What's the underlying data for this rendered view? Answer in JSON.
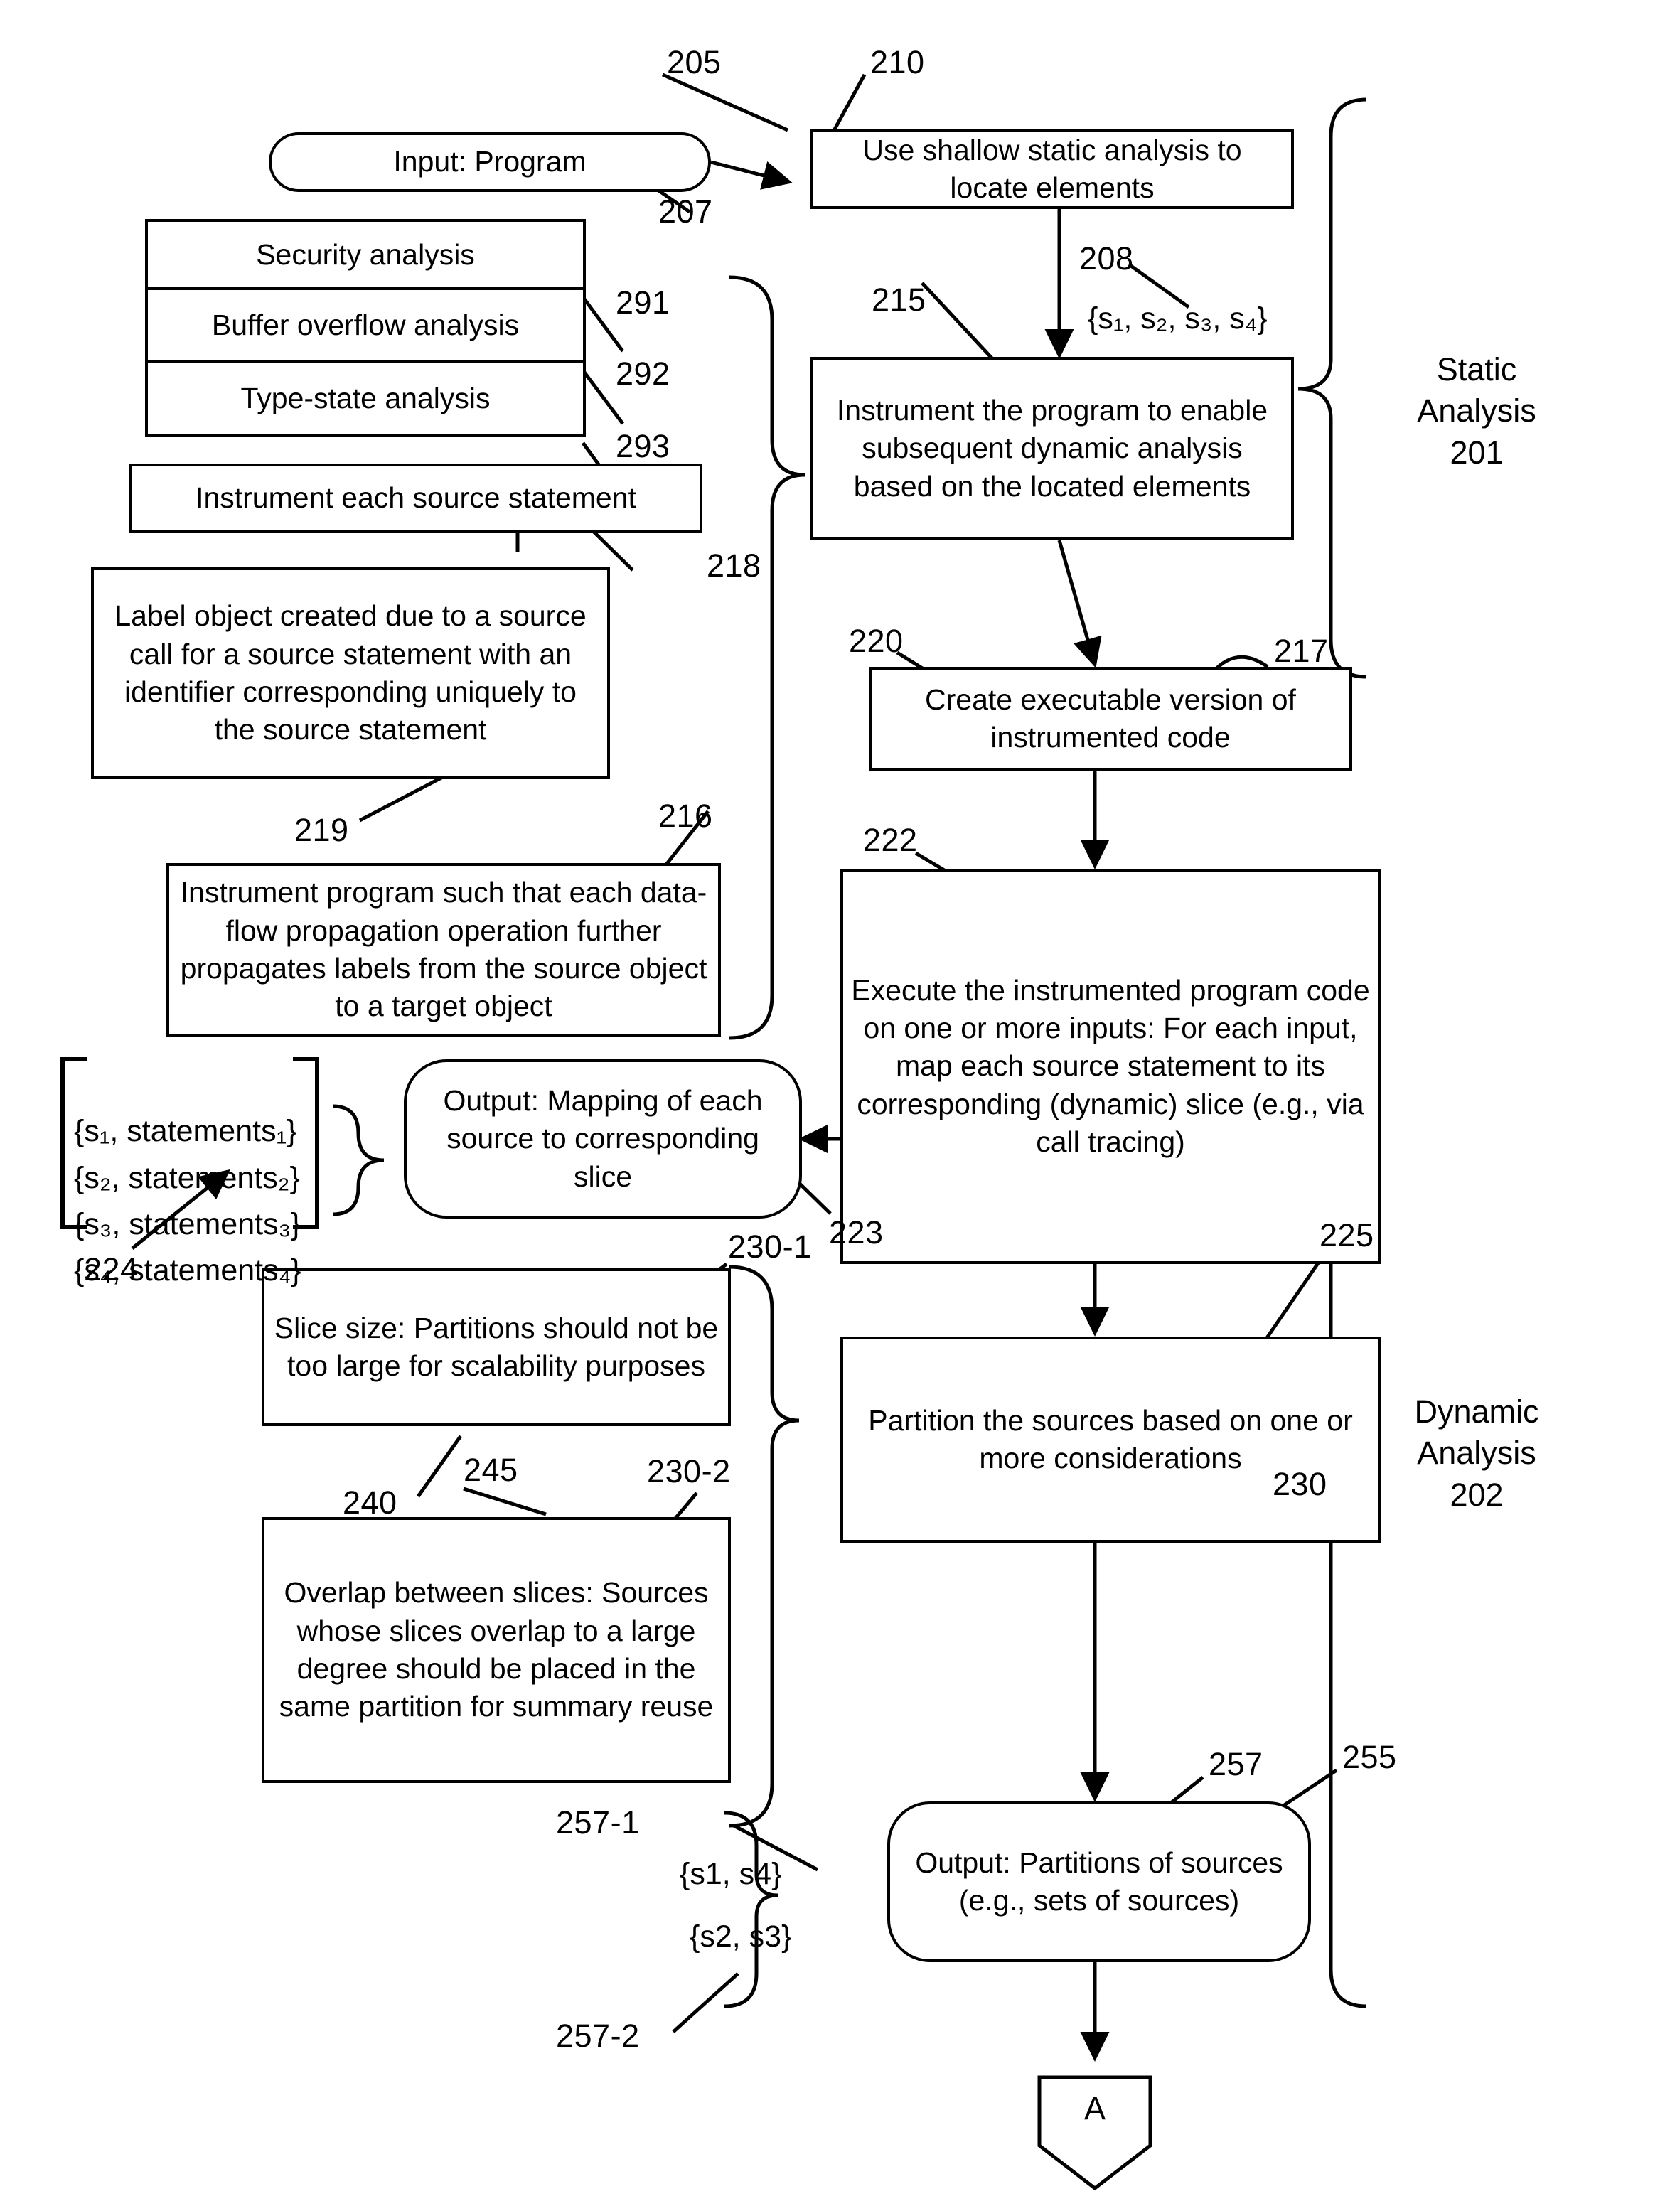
{
  "figure": {
    "title": "Static and dynamic analysis partitioning flowchart",
    "ink_color": "#000000",
    "background_color": "#ffffff"
  },
  "nodes": {
    "input_program": {
      "label": "Input: Program",
      "ref": "205",
      "shape": "terminal"
    },
    "shallow_static": {
      "label": "Use shallow static analysis to locate elements",
      "ref": "210",
      "shape": "process"
    },
    "instrument_program": {
      "label": "Instrument the program to enable subsequent dynamic analysis based on the located elements",
      "ref": "215",
      "shape": "process"
    },
    "create_executable": {
      "label": "Create executable version of instrumented code",
      "ref": "220",
      "shape": "process"
    },
    "execute_instrumented": {
      "label": "Execute the instrumented program code on one or more inputs:  For each input, map each source statement to its corresponding (dynamic) slice (e.g., via call tracing)",
      "ref": "222",
      "shape": "process"
    },
    "partition_sources": {
      "label": "Partition the sources based on one or more considerations",
      "ref": "225",
      "shape": "process"
    },
    "output_mapping": {
      "label": "Output: Mapping of each source to corresponding slice",
      "ref": "223",
      "shape": "terminal"
    },
    "output_partitions": {
      "label": "Output: Partitions of sources (e.g., sets of sources)",
      "ref": "255",
      "shape": "terminal"
    },
    "security_analysis": {
      "label": "Security analysis",
      "ref": "291",
      "shape": "process"
    },
    "buffer_overflow_analysis": {
      "label": "Buffer overflow analysis",
      "ref": "292",
      "shape": "process"
    },
    "type_state_analysis": {
      "label": "Type-state analysis",
      "ref": "293",
      "shape": "process"
    },
    "instrument_each_source": {
      "label": "Instrument each source statement",
      "ref": "218",
      "shape": "process"
    },
    "label_object": {
      "label": "Label object created due to a source call for a source statement with an identifier corresponding uniquely to the source statement",
      "ref": "219",
      "shape": "process"
    },
    "instrument_dataflow": {
      "label": "Instrument program such that each data-flow propagation operation further propagates labels from the source object to a target object",
      "ref": "216",
      "shape": "process"
    },
    "slice_size_consideration": {
      "label": "Slice size:  Partitions should not be too large for scalability purposes",
      "ref": "230-1",
      "shape": "process"
    },
    "overlap_consideration": {
      "label": "Overlap between slices: Sources whose slices overlap to a large degree should be placed in the same partition for summary reuse",
      "ref": "230-2",
      "shape": "process"
    },
    "offpage_connector_a": {
      "label": "A",
      "shape": "offpage-connector"
    }
  },
  "reference_numerals": {
    "n205": "205",
    "n207": "207",
    "n208": "208",
    "n210": "210",
    "n215": "215",
    "n216": "216",
    "n217": "217",
    "n218": "218",
    "n219": "219",
    "n220": "220",
    "n222": "222",
    "n223": "223",
    "n224": "224",
    "n225": "225",
    "n230": "230",
    "n230_1": "230-1",
    "n230_2": "230-2",
    "n240": "240",
    "n245": "245",
    "n255": "255",
    "n257": "257",
    "n257_1": "257-1",
    "n257_2": "257-2",
    "n291": "291",
    "n292": "292",
    "n293": "293"
  },
  "annotations": {
    "located_sources_set": "{s₁, s₂, s₃, s₄}",
    "slice_mapping_list": "{s₁, statements₁}\n{s₂, statements₂}\n{s₃, statements₃}\n{s₄, statements₄}",
    "partition_1": "{s1, s4}",
    "partition_2": "{s2, s3}"
  },
  "group_labels": {
    "static_analysis": "Static\nAnalysis\n201",
    "dynamic_analysis": "Dynamic\nAnalysis\n202"
  }
}
